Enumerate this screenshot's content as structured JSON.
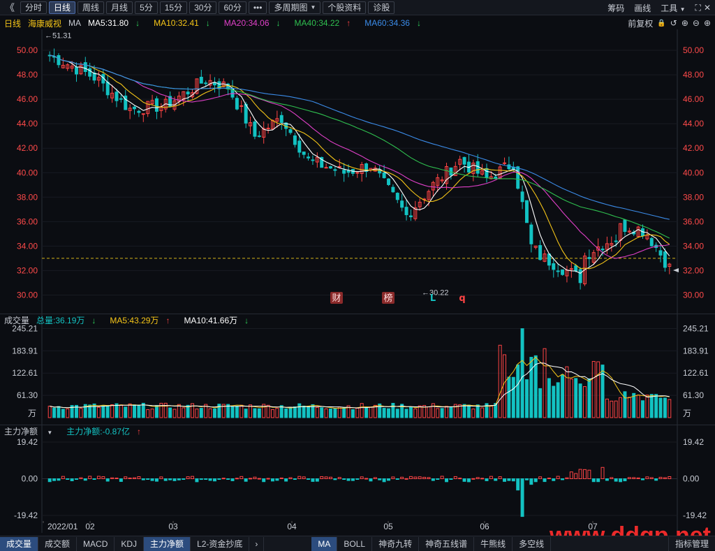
{
  "toolbar": {
    "back": "《",
    "tabs": [
      "分时",
      "日线",
      "周线",
      "月线",
      "5分",
      "15分",
      "30分",
      "60分"
    ],
    "active_tab": "日线",
    "more": "•••",
    "multi_period": "多周期图",
    "stock_info": "个股资料",
    "diagnose": "诊股",
    "right": [
      "筹码",
      "画线",
      "工具"
    ]
  },
  "legend": {
    "period": "日线",
    "stock": "海康威视",
    "indicator": "MA",
    "ma5": "MA5:31.80",
    "ma5_arrow": "↓",
    "ma10": "MA10:32.41",
    "ma10_arrow": "↓",
    "ma20": "MA20:34.06",
    "ma20_arrow": "↓",
    "ma40": "MA40:34.22",
    "ma40_arrow": "↑",
    "ma60": "MA60:34.36",
    "ma60_arrow": "↓",
    "adjust": "前复权",
    "tools": [
      "🔒",
      "↺",
      "⊕",
      "⊖",
      "⊕"
    ]
  },
  "volume_head": {
    "title": "成交量",
    "total": "总量:36.19万",
    "total_arrow": "↓",
    "ma5": "MA5:43.29万",
    "ma5_arrow": "↑",
    "ma10": "MA10:41.66万",
    "ma10_arrow": "↓"
  },
  "flow_head": {
    "title": "主力净额",
    "caret": "▼",
    "value": "主力净额:-0.87亿",
    "value_arrow": "↑"
  },
  "bottom_tabs": {
    "left": [
      "成交量",
      "成交额",
      "MACD",
      "KDJ",
      "主力净额",
      "L2-资金抄底"
    ],
    "left_active": [
      "成交量",
      "主力净额"
    ],
    "arrow": "›",
    "right": [
      "MA",
      "BOLL",
      "神奇九转",
      "神奇五线谱",
      "牛熊线",
      "多空线"
    ],
    "right_active": "MA",
    "end": "指标管理"
  },
  "colors": {
    "up": "#ff4444",
    "down": "#13c2c2",
    "ma5": "#ffffff",
    "ma10": "#f5c518",
    "ma20": "#e040c8",
    "ma40": "#2fbf4f",
    "ma60": "#3b8be8",
    "axis_red": "#ff4a4a",
    "grid": "#1b1f27"
  },
  "chart_data": {
    "type": "candlestick",
    "price_axis": {
      "ticks": [
        50.0,
        48.0,
        46.0,
        44.0,
        42.0,
        40.0,
        38.0,
        36.0,
        34.0,
        32.0,
        30.0
      ],
      "tick_labels": [
        "50.00",
        "48.00",
        "46.00",
        "44.00",
        "42.00",
        "40.00",
        "38.00",
        "36.00",
        "34.00",
        "32.00",
        "30.00"
      ],
      "ylim": [
        29.0,
        51.6
      ]
    },
    "x_axis_labels": [
      "2022/01",
      "02",
      "03",
      "04",
      "05",
      "06",
      "07"
    ],
    "annotations": {
      "high_label": "←51.31",
      "low_label": "←30.22",
      "current_price": 33.0,
      "markers": [
        "财",
        "榜",
        "L",
        "q"
      ]
    },
    "daily_ohlc_start": [
      49.6,
      50.4,
      48.2,
      48.6
    ],
    "ma_end_values": {
      "ma5": 31.8,
      "ma10": 32.41,
      "ma20": 34.06,
      "ma40": 34.22,
      "ma60": 34.36
    },
    "volume_axis": {
      "tick_labels": [
        "245.21",
        "183.91",
        "122.61",
        "61.30"
      ],
      "ticks": [
        245.21,
        183.91,
        122.61,
        61.3
      ],
      "unit": "万",
      "ylim": [
        0,
        250
      ]
    },
    "flow_axis": {
      "tick_labels": [
        "19.42",
        "0.00",
        "-19.42"
      ],
      "ticks": [
        19.42,
        0.0,
        -19.42
      ],
      "ylim": [
        -22,
        22
      ]
    },
    "watermark": "www.ddgp.net"
  }
}
